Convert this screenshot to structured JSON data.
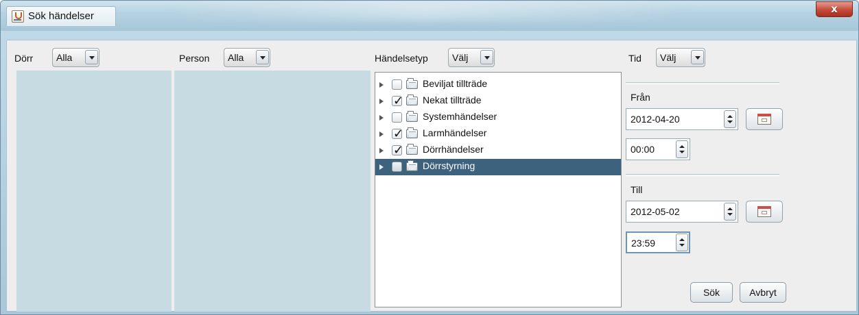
{
  "window": {
    "title": "Sök händelser",
    "close_icon_label": "x"
  },
  "filters": {
    "door": {
      "label": "Dörr",
      "value": "Alla"
    },
    "person": {
      "label": "Person",
      "value": "Alla"
    },
    "event_type": {
      "label": "Händelsetyp",
      "value": "Välj"
    },
    "time": {
      "label": "Tid",
      "value": "Välj"
    }
  },
  "event_tree": [
    {
      "label": "Beviljat tillträde",
      "checked": false,
      "selected": false
    },
    {
      "label": "Nekat tillträde",
      "checked": true,
      "selected": false
    },
    {
      "label": "Systemhändelser",
      "checked": false,
      "selected": false
    },
    {
      "label": "Larmhändelser",
      "checked": true,
      "selected": false
    },
    {
      "label": "Dörrhändelser",
      "checked": true,
      "selected": false
    },
    {
      "label": "Dörrstyrning",
      "checked": false,
      "selected": true
    }
  ],
  "date_range": {
    "from_label": "Från",
    "from_date": "2012-04-20",
    "from_time": "00:00",
    "to_label": "Till",
    "to_date": "2012-05-02",
    "to_time": "23:59"
  },
  "buttons": {
    "search": "Sök",
    "cancel": "Avbryt"
  },
  "icons": {
    "app": "java-coffee-icon",
    "close": "close-icon",
    "dropdown": "chevron-down-icon",
    "expand": "triangle-right-icon",
    "folder": "folder-icon",
    "spinner": "spinner-arrows-icon",
    "calendar": "calendar-icon"
  },
  "colors": {
    "title_bar": "#b7d3e3",
    "selected_row": "#3d627e",
    "close_button": "#c54b3a",
    "list_panel": "#c7dbe3"
  }
}
